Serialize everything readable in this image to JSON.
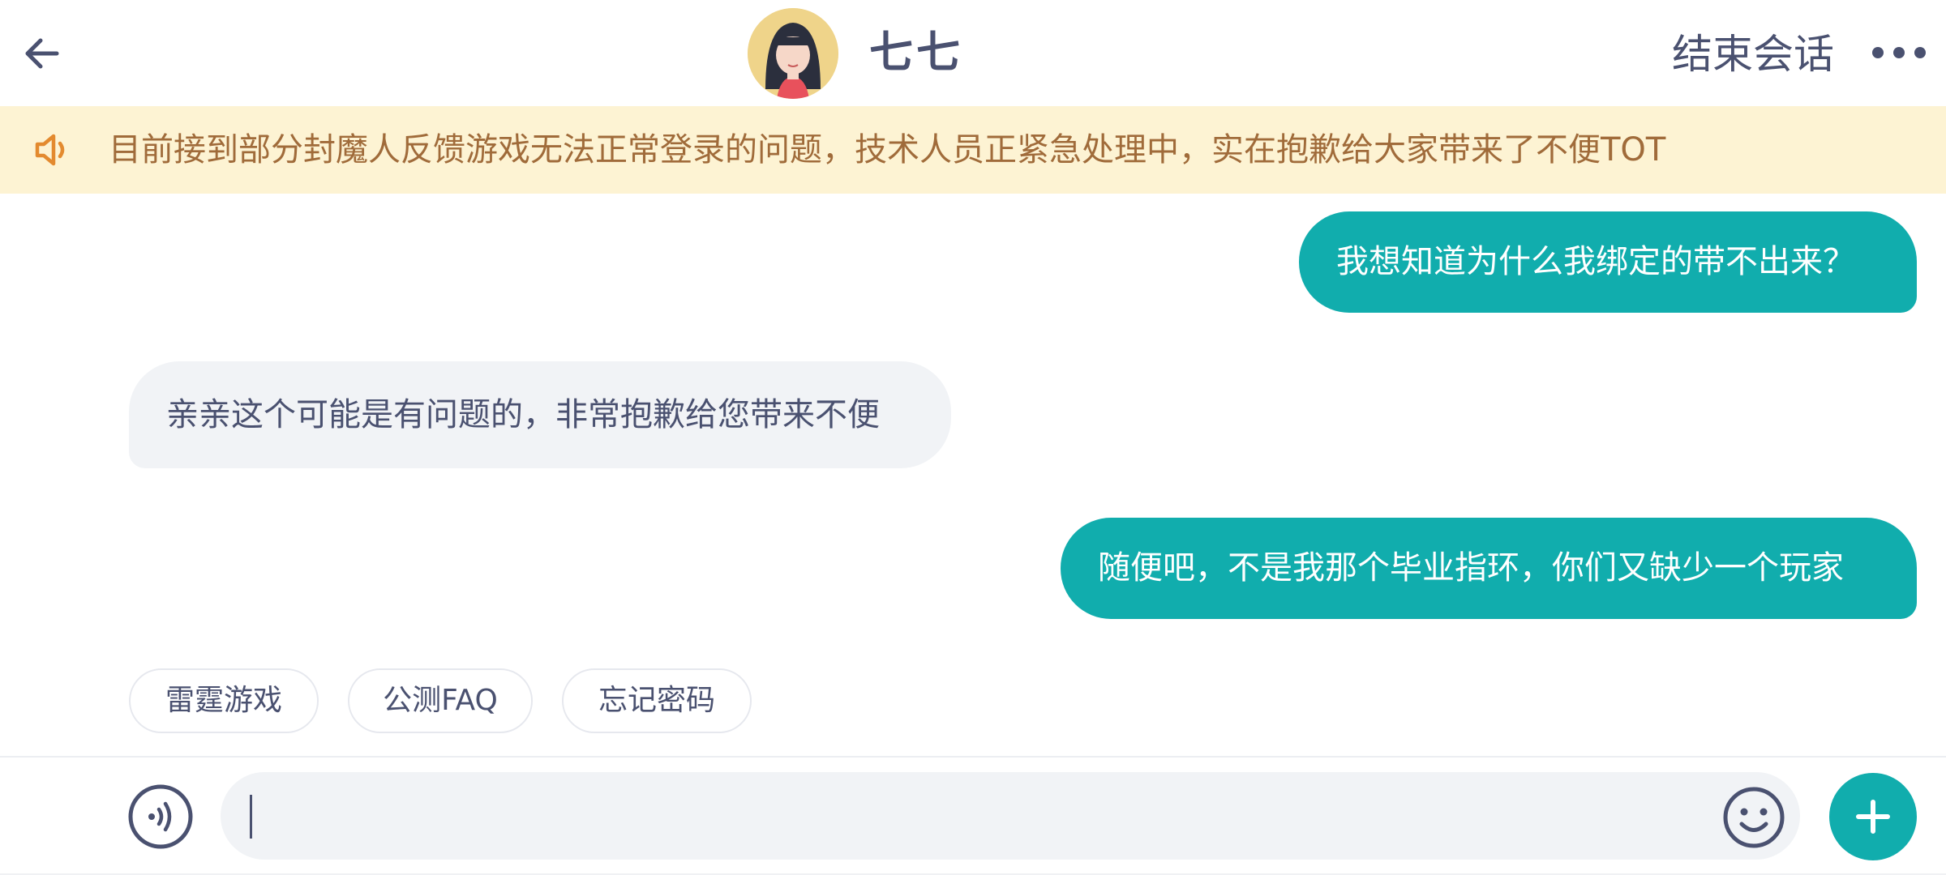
{
  "header": {
    "title": "七七",
    "end_session_label": "结束会话",
    "back_icon": "arrow-left-icon",
    "more_icon": "more-dots-icon"
  },
  "notice": {
    "icon": "speaker-icon",
    "text": "目前接到部分封魔人反馈游戏无法正常登录的问题，技术人员正紧急处理中，实在抱歉给大家带来了不便TOT"
  },
  "messages": [
    {
      "sender": "user",
      "text": "我想知道为什么我绑定的带不出来？"
    },
    {
      "sender": "agent",
      "text": "亲亲这个可能是有问题的，非常抱歉给您带来不便"
    },
    {
      "sender": "user",
      "text": "随便吧，不是我那个毕业指环，你们又缺少一个玩家"
    }
  ],
  "quick_replies": [
    "雷霆游戏",
    "公测FAQ",
    "忘记密码"
  ],
  "input": {
    "value": "",
    "voice_icon": "voice-icon",
    "emoji_icon": "emoji-icon",
    "plus_icon": "plus-icon"
  },
  "colors": {
    "accent": "#11adad",
    "notice_bg": "#fdf3d3",
    "notice_text": "#a06b3a",
    "text_dark": "#4a5170",
    "agent_bubble": "#f1f3f6"
  }
}
